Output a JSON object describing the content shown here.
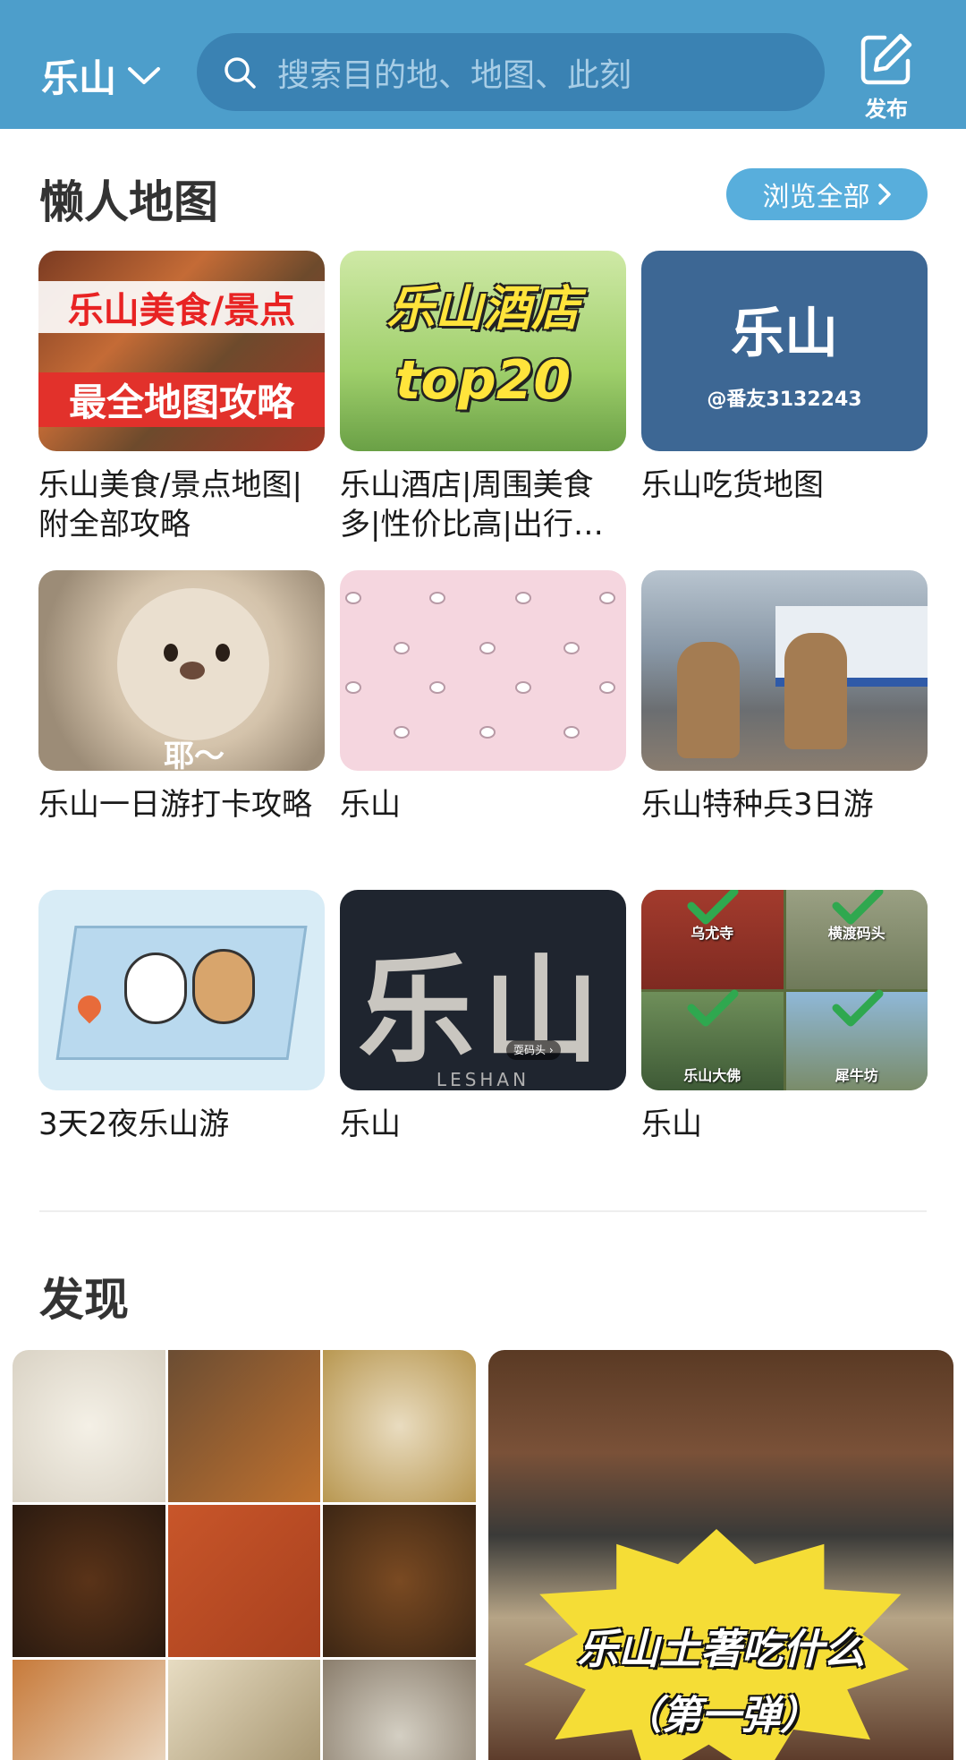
{
  "header": {
    "city": "乐山",
    "search_placeholder": "搜索目的地、地图、此刻",
    "publish_label": "发布",
    "bg_color": "#4d9ecb"
  },
  "lazy_maps": {
    "title": "懒人地图",
    "browse_all_label": "浏览全部",
    "cards": [
      {
        "caption": "乐山美食/景点地图|附全部攻略",
        "thumb_line1": "乐山美食/景点",
        "thumb_line2": "最全地图攻略"
      },
      {
        "caption": "乐山酒店|周围美食多|性价比高|出行…",
        "thumb_line1": "乐山酒店",
        "thumb_line2": "top20"
      },
      {
        "caption": "乐山吃货地图",
        "thumb_line1": "乐山",
        "thumb_line2": "@番友3132243"
      },
      {
        "caption": "乐山一日游打卡攻略",
        "thumb_text": "耶～"
      },
      {
        "caption": "乐山"
      },
      {
        "caption": "乐山特种兵3日游"
      },
      {
        "caption": "3天2夜乐山游"
      },
      {
        "caption": "乐山",
        "thumb_line1": "乐山",
        "thumb_pill": "耍码头 ›",
        "thumb_sub": "LESHAN"
      },
      {
        "caption": "乐山",
        "thumb_labels": [
          "乌尤寺",
          "横渡码头",
          "乐山大佛",
          "犀牛坊"
        ]
      }
    ]
  },
  "discover": {
    "title": "发现",
    "right_card_line1": "乐山土著吃什么",
    "right_card_line2": "（第一弹）"
  }
}
